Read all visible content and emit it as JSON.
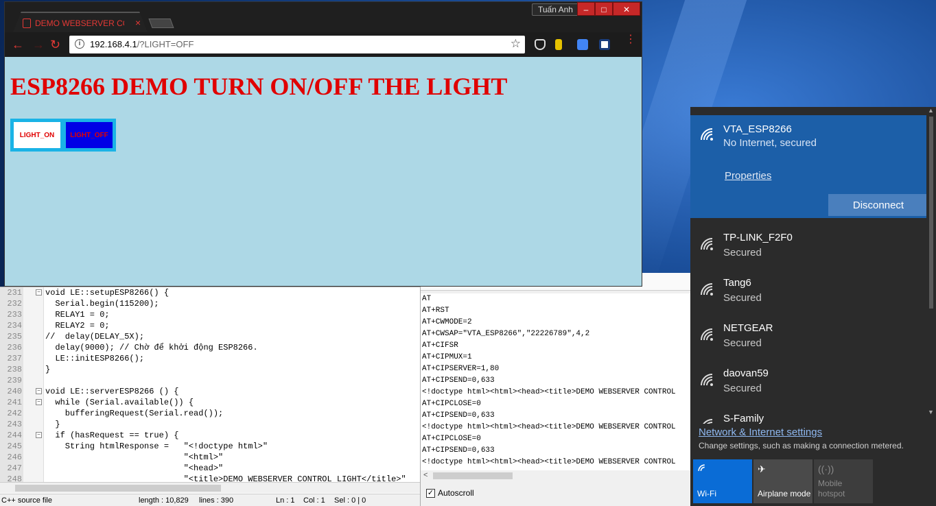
{
  "browser": {
    "tab_title": "DEMO WEBSERVER CON",
    "tab_close": "×",
    "user": "Tuấn Anh",
    "window_buttons": [
      "–",
      "□",
      "✕"
    ],
    "url_host": "192.168.4.1",
    "url_path": "/?LIGHT=OFF",
    "page": {
      "heading": "ESP8266 DEMO TURN ON/OFF THE LIGHT",
      "btn_on": "LIGHT_ON",
      "btn_off": "LIGHT_OFF"
    }
  },
  "editor": {
    "lines": [
      {
        "n": "231",
        "fold": "−",
        "text": "void LE::setupESP8266() {"
      },
      {
        "n": "232",
        "fold": "",
        "text": "  Serial.begin(115200);"
      },
      {
        "n": "233",
        "fold": "",
        "text": "  RELAY1 = 0;"
      },
      {
        "n": "234",
        "fold": "",
        "text": "  RELAY2 = 0;"
      },
      {
        "n": "235",
        "fold": "",
        "text": "//  delay(DELAY_5X);"
      },
      {
        "n": "236",
        "fold": "",
        "text": "  delay(9000); // Chờ để khởi động ESP8266."
      },
      {
        "n": "237",
        "fold": "",
        "text": "  LE::initESP8266();"
      },
      {
        "n": "238",
        "fold": "",
        "text": "}"
      },
      {
        "n": "239",
        "fold": "",
        "text": ""
      },
      {
        "n": "240",
        "fold": "−",
        "text": "void LE::serverESP8266 () {"
      },
      {
        "n": "241",
        "fold": "−",
        "text": "  while (Serial.available()) {"
      },
      {
        "n": "242",
        "fold": "",
        "text": "    bufferingRequest(Serial.read());"
      },
      {
        "n": "243",
        "fold": "",
        "text": "  }"
      },
      {
        "n": "244",
        "fold": "−",
        "text": "  if (hasRequest == true) {"
      },
      {
        "n": "245",
        "fold": "",
        "text": "    String htmlResponse =   \"<!doctype html>\""
      },
      {
        "n": "246",
        "fold": "",
        "text": "                            \"<html>\""
      },
      {
        "n": "247",
        "fold": "",
        "text": "                            \"<head>\""
      },
      {
        "n": "248",
        "fold": "",
        "text": "                            \"<title>DEMO WEBSERVER CONTROL LIGHT</title>\""
      }
    ]
  },
  "serial": {
    "lines": [
      "AT",
      "AT+RST",
      "AT+CWMODE=2",
      "AT+CWSAP=\"VTA_ESP8266\",\"22226789\",4,2",
      "AT+CIFSR",
      "AT+CIPMUX=1",
      "AT+CIPSERVER=1,80",
      "AT+CIPSEND=0,633",
      "<!doctype html><html><head><title>DEMO WEBSERVER CONTROL",
      "AT+CIPCLOSE=0",
      "AT+CIPSEND=0,633",
      "<!doctype html><html><head><title>DEMO WEBSERVER CONTROL",
      "AT+CIPCLOSE=0",
      "AT+CIPSEND=0,633",
      "<!doctype html><html><head><title>DEMO WEBSERVER CONTROL"
    ],
    "autoscroll_label": "Autoscroll",
    "autoscroll_checked": "✓"
  },
  "statusbar": {
    "file_type": "C++ source file",
    "length": "length : 10,829",
    "lines": "lines : 390",
    "ln": "Ln : 1",
    "col": "Col : 1",
    "sel": "Sel : 0 | 0"
  },
  "wifi": {
    "connected": {
      "name": "VTA_ESP8266",
      "status": "No Internet, secured",
      "properties": "Properties",
      "disconnect": "Disconnect"
    },
    "networks": [
      {
        "name": "TP-LINK_F2F0",
        "status": "Secured"
      },
      {
        "name": "Tang6",
        "status": "Secured"
      },
      {
        "name": "NETGEAR",
        "status": "Secured"
      },
      {
        "name": "daovan59",
        "status": "Secured"
      },
      {
        "name": "S-Family",
        "status": ""
      }
    ],
    "settings_link": "Network & Internet settings",
    "settings_sub": "Change settings, such as making a connection metered.",
    "quick_actions": [
      {
        "label": "Wi-Fi",
        "icon": "wifi-icon"
      },
      {
        "label": "Airplane mode",
        "icon": "airplane-icon"
      },
      {
        "label": "Mobile hotspot",
        "icon": "hotspot-icon"
      }
    ]
  },
  "colors": {
    "page_bg": "#add8e6",
    "heading": "#e00000",
    "wifi_selected": "#1c5fa8",
    "wifi_active_tile": "#0a6cd6"
  }
}
